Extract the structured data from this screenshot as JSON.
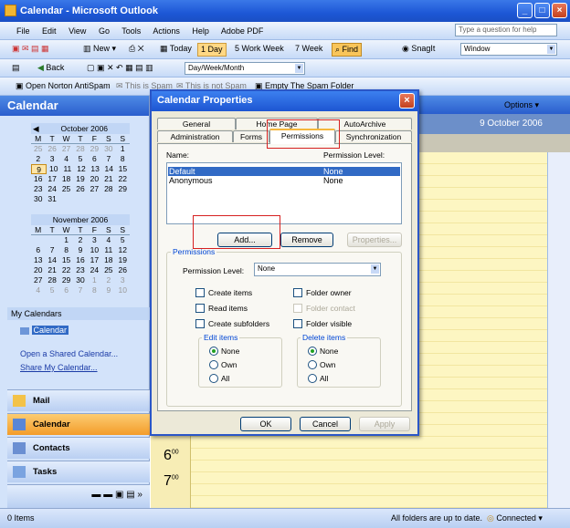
{
  "window": {
    "title": "Calendar - Microsoft Outlook"
  },
  "menu": [
    "File",
    "Edit",
    "View",
    "Go",
    "Tools",
    "Actions",
    "Help",
    "Adobe PDF"
  ],
  "help_placeholder": "Type a question for help",
  "toolbar1": {
    "new": "New",
    "today": "Today",
    "day": "Day",
    "work_week": "Work Week",
    "week": "Week",
    "find": "Find",
    "snagit": "SnagIt",
    "window": "Window"
  },
  "toolbar2": {
    "back": "Back",
    "view_combo": "Day/Week/Month"
  },
  "toolbar3": {
    "norton": "Open Norton AntiSpam",
    "spam": "This is Spam",
    "notspam": "This is not Spam",
    "empty": "Empty The Spam Folder"
  },
  "sidebar": {
    "title": "Calendar",
    "oct": {
      "title": "October 2006",
      "dows": [
        "M",
        "T",
        "W",
        "T",
        "F",
        "S",
        "S"
      ],
      "weeks": [
        [
          "25",
          "26",
          "27",
          "28",
          "29",
          "30",
          "1"
        ],
        [
          "2",
          "3",
          "4",
          "5",
          "6",
          "7",
          "8"
        ],
        [
          "9",
          "10",
          "11",
          "12",
          "13",
          "14",
          "15"
        ],
        [
          "16",
          "17",
          "18",
          "19",
          "20",
          "21",
          "22"
        ],
        [
          "23",
          "24",
          "25",
          "26",
          "27",
          "28",
          "29"
        ],
        [
          "30",
          "31",
          "",
          "",
          "",
          "",
          ""
        ]
      ]
    },
    "nov": {
      "title": "November 2006",
      "dows": [
        "M",
        "T",
        "W",
        "T",
        "F",
        "S",
        "S"
      ],
      "weeks": [
        [
          "",
          "",
          "1",
          "2",
          "3",
          "4",
          "5"
        ],
        [
          "6",
          "7",
          "8",
          "9",
          "10",
          "11",
          "12"
        ],
        [
          "13",
          "14",
          "15",
          "16",
          "17",
          "18",
          "19"
        ],
        [
          "20",
          "21",
          "22",
          "23",
          "24",
          "25",
          "26"
        ],
        [
          "27",
          "28",
          "29",
          "30",
          "1",
          "2",
          "3"
        ],
        [
          "4",
          "5",
          "6",
          "7",
          "8",
          "9",
          "10"
        ]
      ]
    },
    "my_calendars": "My Calendars",
    "calendar_item": "Calendar",
    "open_shared": "Open a Shared Calendar...",
    "share": "Share My Calendar...",
    "nav": [
      "Mail",
      "Calendar",
      "Contacts",
      "Tasks"
    ]
  },
  "calendar": {
    "options": "Options",
    "date": "9 October 2006",
    "hours": [
      "6",
      "7"
    ],
    "minutes": "00"
  },
  "status": {
    "items": "0 Items",
    "folders": "All folders are up to date.",
    "connected": "Connected"
  },
  "dialog": {
    "title": "Calendar Properties",
    "tabs_top": [
      "General",
      "Home Page",
      "AutoArchive"
    ],
    "tabs_bottom": [
      "Administration",
      "Forms",
      "Permissions",
      "Synchronization"
    ],
    "name_header": "Name:",
    "level_header": "Permission Level:",
    "rows": [
      {
        "name": "Default",
        "level": "None"
      },
      {
        "name": "Anonymous",
        "level": "None"
      }
    ],
    "add": "Add...",
    "remove": "Remove",
    "properties": "Properties...",
    "permissions_group": "Permissions",
    "level_label": "Permission Level:",
    "level_value": "None",
    "create_items": "Create items",
    "read_items": "Read items",
    "create_subfolders": "Create subfolders",
    "folder_owner": "Folder owner",
    "folder_contact": "Folder contact",
    "folder_visible": "Folder visible",
    "edit_items": "Edit items",
    "delete_items": "Delete items",
    "none": "None",
    "own": "Own",
    "all": "All",
    "ok": "OK",
    "cancel": "Cancel",
    "apply": "Apply"
  }
}
